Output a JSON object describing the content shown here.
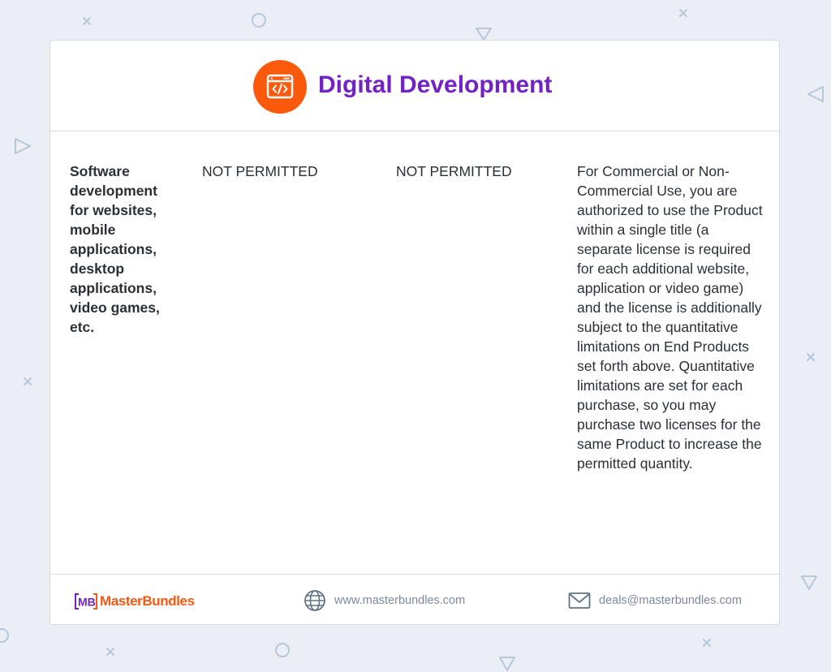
{
  "header": {
    "icon": "code-window-icon",
    "title": "Digital Development",
    "accent_color": "#fb5a0c",
    "title_color": "#7322c4"
  },
  "row": {
    "type": "Software development for websites, mobile applications, desktop applications, video games, etc.",
    "permission_1": "NOT PERMITTED",
    "permission_2": "NOT PERMITTED",
    "description": "For Commercial or Non-Commercial Use, you are authorized to use the Product within a single title (a separate license is required for each additional website, application or video game) and the license is additionally subject to the quantitative limitations on End Products set forth above. Quantitative limitations are set for each purchase, so you may purchase two licenses for the same Product to increase the permitted quantity."
  },
  "footer": {
    "brand": "MasterBundles",
    "brand_mark": "MB",
    "website_icon": "globe-icon",
    "website": "www.masterbundles.com",
    "email_icon": "envelope-icon",
    "email": "deals@masterbundles.com"
  }
}
